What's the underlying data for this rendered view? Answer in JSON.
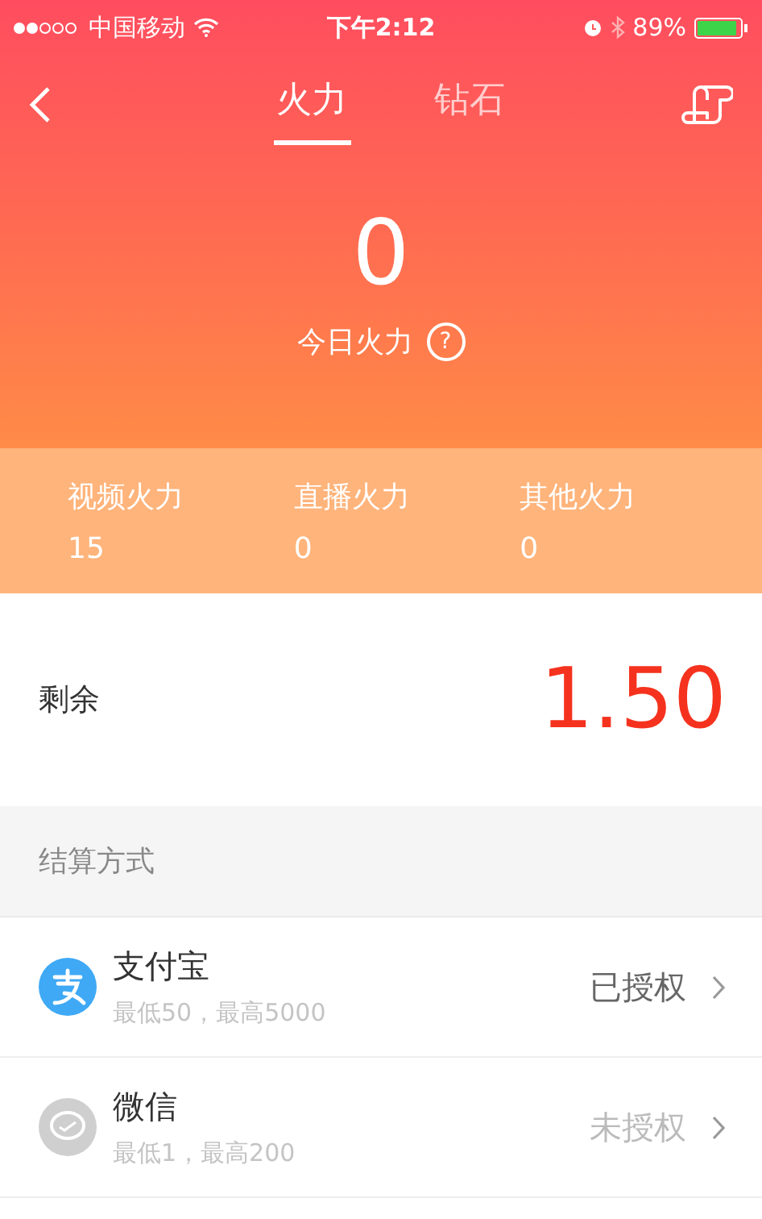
{
  "status_bar": {
    "carrier": "中国移动",
    "time": "下午2:12",
    "battery": "89%"
  },
  "tabs": [
    {
      "label": "火力",
      "selected": true
    },
    {
      "label": "钻石",
      "selected": false
    }
  ],
  "today": {
    "value": "0",
    "label": "今日火力",
    "help": "?"
  },
  "stats": [
    {
      "label": "视频火力",
      "value": "15"
    },
    {
      "label": "直播火力",
      "value": "0"
    },
    {
      "label": "其他火力",
      "value": "0"
    }
  ],
  "balance": {
    "label": "剩余",
    "value": "1.50"
  },
  "section_title": "结算方式",
  "payment_methods": [
    {
      "kind": "alipay",
      "name": "支付宝",
      "limits": "最低50，最高5000",
      "status": "已授权",
      "authorized": true
    },
    {
      "kind": "wechat",
      "name": "微信",
      "limits": "最低1，最高200",
      "status": "未授权",
      "authorized": false
    }
  ]
}
